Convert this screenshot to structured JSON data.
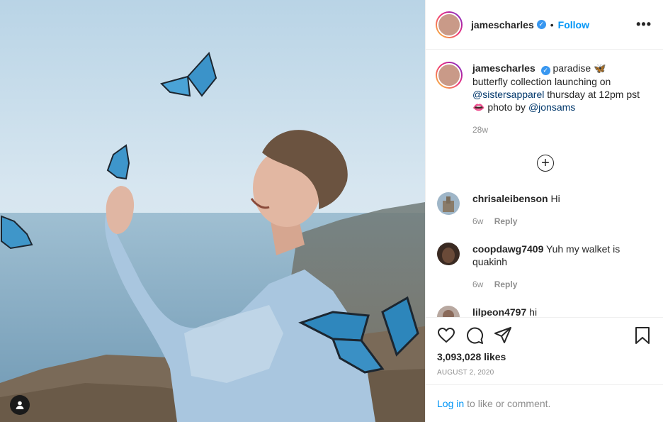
{
  "header": {
    "username": "jamescharles",
    "follow_label": "Follow",
    "separator": "•",
    "more_label": "•••",
    "verified_icon": "verified-badge-icon"
  },
  "caption": {
    "username": "jamescharles",
    "text_1": "paradise",
    "emoji_1": "🦋",
    "text_2": "butterfly collection launching on",
    "mention_1": "@sistersapparel",
    "text_3": "thursday at 12pm pst",
    "emoji_2": "👄",
    "text_4": "photo by",
    "mention_2": "@jonsams",
    "time": "28w"
  },
  "load_more": {
    "label": "+"
  },
  "comments": [
    {
      "username": "chrisaleibenson",
      "text": "Hi",
      "time": "6w",
      "reply_label": "Reply"
    },
    {
      "username": "coopdawg7409",
      "text": "Yuh my walket is quakinh",
      "time": "6w",
      "reply_label": "Reply"
    },
    {
      "username": "lilpeon4797",
      "text": "hi"
    }
  ],
  "actions": {
    "like_icon": "heart-icon",
    "comment_icon": "comment-icon",
    "share_icon": "share-icon",
    "save_icon": "bookmark-icon"
  },
  "likes": "3,093,028 likes",
  "date": "AUGUST 2, 2020",
  "login": {
    "link_label": "Log in",
    "rest_text": "to like or comment."
  },
  "colors": {
    "accent": "#0095f6",
    "link": "#00376b",
    "muted": "#8e8e8e",
    "text": "#262626"
  }
}
